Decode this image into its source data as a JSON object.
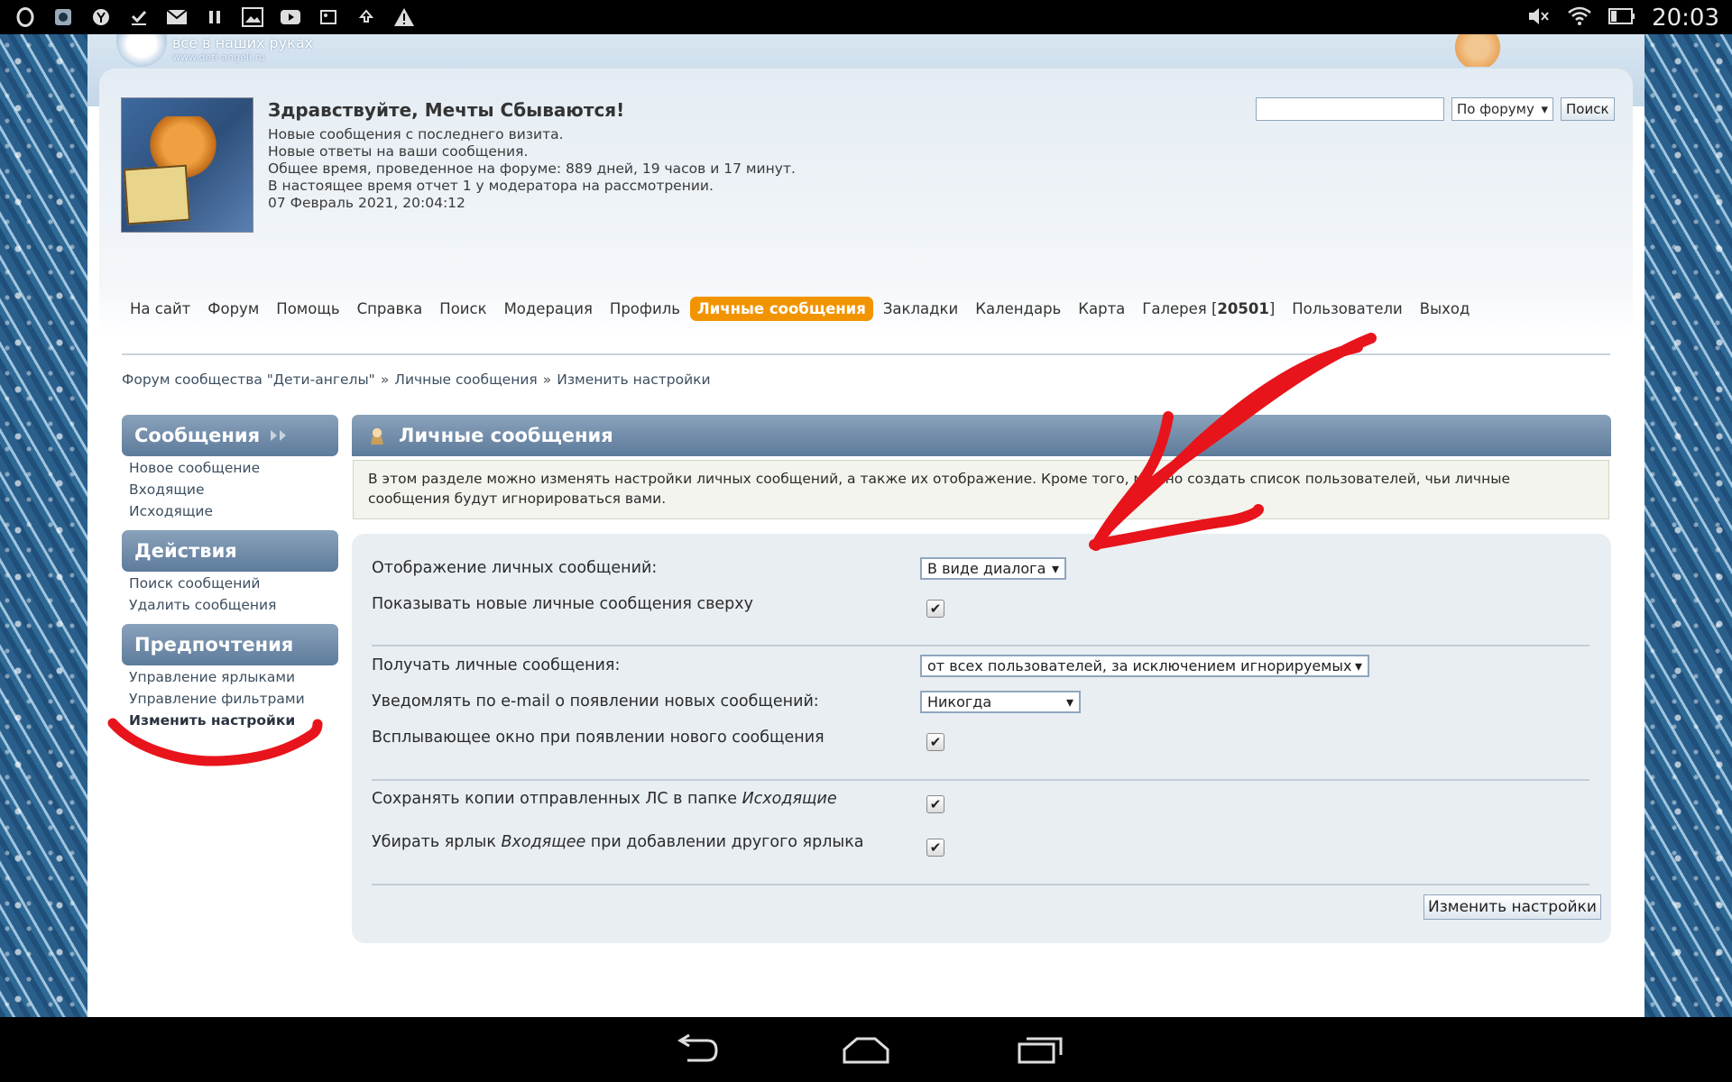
{
  "status_bar": {
    "time": "20:03",
    "left_icons": [
      "opera-icon",
      "browser-icon",
      "yandex-icon",
      "download-done-icon",
      "mail-icon",
      "pause-icon",
      "image-icon",
      "youtube-icon",
      "gallery-icon",
      "upload-icon",
      "warning-icon"
    ],
    "right_icons": [
      "mute-icon",
      "wifi-icon",
      "battery-icon"
    ]
  },
  "site": {
    "logo_text": "все в наших руках",
    "logo_url_text": "www.deti-angeli.ru"
  },
  "welcome": {
    "title": "Здравствуйте, Мечты Сбываются!",
    "lines": [
      "Новые сообщения с последнего визита.",
      "Новые ответы на ваши сообщения.",
      "Общее время, проведенное на форуме: 889 дней, 19 часов и 17 минут.",
      "В настоящее время отчет 1 у модератора на рассмотрении.",
      "07 Февраль 2021, 20:04:12"
    ]
  },
  "search": {
    "value": "",
    "scope": "По форуму",
    "button": "Поиск"
  },
  "nav": {
    "items": [
      {
        "label": "На сайт",
        "active": false
      },
      {
        "label": "Форум",
        "active": false
      },
      {
        "label": "Помощь",
        "active": false
      },
      {
        "label": "Справка",
        "active": false
      },
      {
        "label": "Поиск",
        "active": false
      },
      {
        "label": "Модерация",
        "active": false
      },
      {
        "label": "Профиль",
        "active": false
      },
      {
        "label": "Личные сообщения",
        "active": true
      },
      {
        "label": "Закладки",
        "active": false
      },
      {
        "label": "Календарь",
        "active": false
      },
      {
        "label": "Карта",
        "active": false
      },
      {
        "label": "Галерея [",
        "count": "20501",
        "tail": "]",
        "active": false
      },
      {
        "label": "Пользователи",
        "active": false
      },
      {
        "label": "Выход",
        "active": false
      }
    ]
  },
  "breadcrumb": [
    "Форум сообщества \"Дети-ангелы\"",
    "Личные сообщения",
    "Изменить настройки"
  ],
  "breadcrumb_separator": "»",
  "sidebar": {
    "sections": [
      {
        "title": "Сообщения",
        "links": [
          "Новое сообщение",
          "Входящие",
          "Исходящие"
        ]
      },
      {
        "title": "Действия",
        "links": [
          "Поиск сообщений",
          "Удалить сообщения"
        ]
      },
      {
        "title": "Предпочтения",
        "links": [
          "Управление ярлыками",
          "Управление фильтрами",
          "Изменить настройки"
        ],
        "current": "Изменить настройки"
      }
    ]
  },
  "main": {
    "title": "Личные сообщения",
    "info": "В этом разделе можно изменять настройки личных сообщений, а также их отображение. Кроме того, можно создать список пользователей, чьи личные сообщения будут игнорироваться вами.",
    "settings": {
      "display_label": "Отображение личных сообщений:",
      "display_value": "В виде диалога",
      "show_new_first_label": "Показывать новые личные сообщения сверху",
      "show_new_first_checked": true,
      "receive_label": "Получать личные сообщения:",
      "receive_value": "от всех пользователей, за исключением игнорируемых",
      "email_notify_label": "Уведомлять по e-mail о появлении новых сообщений:",
      "email_notify_value": "Никогда",
      "popup_label": "Всплывающее окно при появлении нового сообщения",
      "popup_checked": true,
      "save_copies_label_pre": "Сохранять копии отправленных ЛС в папке ",
      "save_copies_label_em": "Исходящие",
      "save_copies_checked": true,
      "remove_inbox_label_pre": "Убирать ярлык ",
      "remove_inbox_label_em": "Входящее",
      "remove_inbox_label_post": " при добавлении другого ярлыка",
      "remove_inbox_checked": true,
      "submit": "Изменить настройки"
    }
  },
  "colors": {
    "nav_active": "#f29400",
    "header_blue": "#5d7b9b",
    "annotation_red": "#e8141b"
  },
  "android_nav": [
    "back-icon",
    "home-icon",
    "recents-icon"
  ]
}
